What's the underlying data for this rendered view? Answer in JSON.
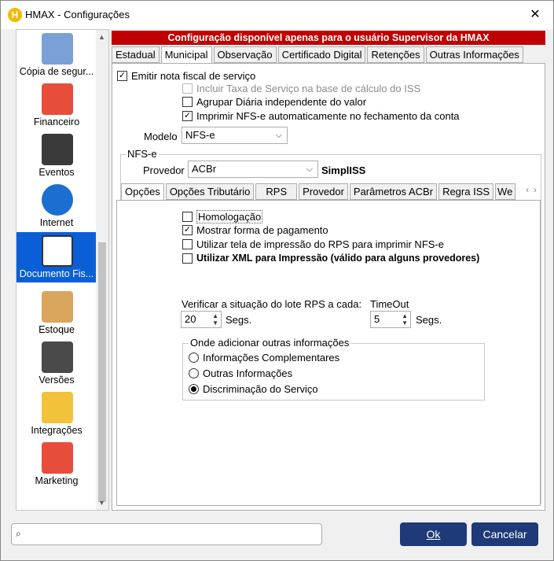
{
  "window": {
    "title": "HMAX - Configurações",
    "icon_letter": "H"
  },
  "sidebar": {
    "items": [
      {
        "label": "Cópia de segur...",
        "icon": "database-backup-icon",
        "color": "#7aa0d8"
      },
      {
        "label": "Financeiro",
        "icon": "financial-chart-icon",
        "color": "#e84d3b"
      },
      {
        "label": "Eventos",
        "icon": "wallet-icon",
        "color": "#3a3a3a"
      },
      {
        "label": "Internet",
        "icon": "globe-icon",
        "color": "#1a6fd0"
      },
      {
        "label": "Documento Fis...",
        "icon": "clipboard-icon",
        "color": "#ffffff"
      },
      {
        "label": "Estoque",
        "icon": "box-icon",
        "color": "#d9a65c"
      },
      {
        "label": "Versões",
        "icon": "book-icon",
        "color": "#4a4a4a"
      },
      {
        "label": "Integrações",
        "icon": "folder-network-icon",
        "color": "#f3c23b"
      },
      {
        "label": "Marketing",
        "icon": "growth-chart-icon",
        "color": "#e84d3b"
      }
    ]
  },
  "banner": {
    "text": "Configuração disponível apenas para o usuário Supervisor da HMAX",
    "color": "#c00000"
  },
  "tabs": [
    "Estadual",
    "Municipal",
    "Observação",
    "Certificado Digital",
    "Retenções",
    "Outras Informações"
  ],
  "municipal": {
    "emitir": "Emitir nota fiscal de serviço",
    "incluir_taxa": "Incluir Taxa de Serviço na base de cálculo do ISS",
    "agrupar": "Agrupar Diária independente do valor",
    "imprimir": "Imprimir NFS-e automaticamente no fechamento da conta",
    "modelo_label": "Modelo",
    "modelo_value": "NFS-e",
    "nfse_group": "NFS-e",
    "provedor_label": "Provedor",
    "provedor_value": "ACBr",
    "provedor_extra": "SimplISS"
  },
  "subtabs": [
    "Opções",
    "Opções Tributário",
    "RPS",
    "Provedor",
    "Parâmetros ACBr",
    "Regra ISS",
    "We"
  ],
  "opcoes": {
    "homologacao": "Homologação",
    "mostrar_forma": "Mostrar forma de pagamento",
    "utilizar_tela": "Utilizar tela de impressão do RPS para imprimir NFS-e",
    "utilizar_xml": "Utilizar XML para Impressão (válido para alguns provedores)",
    "verificar_label": "Verificar a situação do lote RPS a cada:",
    "verificar_value": "20",
    "segs1": "Segs.",
    "timeout_label": "TimeOut",
    "timeout_value": "5",
    "segs2": "Segs.",
    "onde_group": "Onde adicionar outras informações",
    "radio1": "Informações Complementares",
    "radio2": "Outras Informações",
    "radio3": "Discriminação do Serviço"
  },
  "buttons": {
    "ok": "Ok",
    "cancel": "Cancelar"
  },
  "search": {
    "placeholder": ""
  }
}
